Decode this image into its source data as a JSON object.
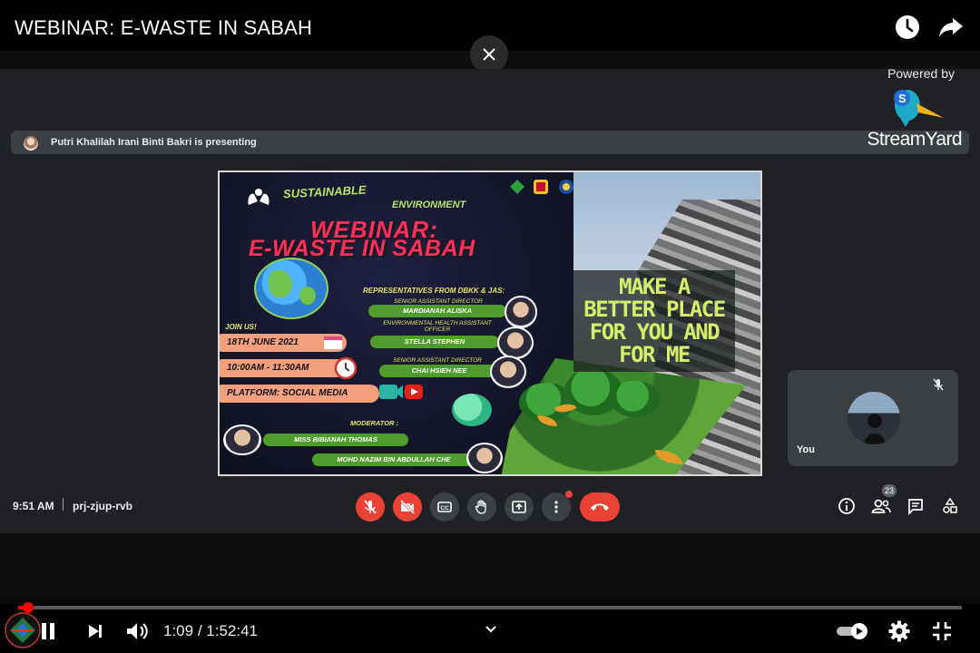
{
  "video": {
    "title": "WEBINAR: E-WASTE IN SABAH"
  },
  "top_actions": {
    "watch_later_icon": "clock-icon",
    "share_icon": "share-arrow-icon",
    "close_icon": "close-icon"
  },
  "meet": {
    "presenting_text": "Putri Khalilah Irani Binti Bakri is presenting",
    "powered_by": "Powered by",
    "brand": "StreamYard",
    "self_label": "You",
    "time": "9:51 AM",
    "meeting_code": "prj-zjup-rvb",
    "participants_count": "23",
    "controls": [
      "mic-off-icon",
      "camera-off-icon",
      "captions-icon",
      "raise-hand-icon",
      "present-icon",
      "more-options-icon",
      "hang-up-icon"
    ],
    "right_controls": [
      "info-icon",
      "people-icon",
      "chat-icon",
      "activities-icon"
    ],
    "colors": {
      "surface": "#202124",
      "button": "#3c4043",
      "danger": "#ea4335"
    }
  },
  "slide": {
    "top_line": "SUSTAINABLE",
    "top_line_2": "ENVIRONMENT",
    "webinar": "WEBINAR:",
    "topic": "E-WASTE IN SABAH",
    "reps_heading": "REPRESENTATIVES FROM DBKK & JAS:",
    "speakers": [
      {
        "role": "SENIOR ASSISTANT DIRECTOR",
        "name": "MARDIANAH ALISKA"
      },
      {
        "role": "ENVIRONMENTAL HEALTH ASSISTANT OFFICER",
        "name": "STELLA STEPHEN"
      },
      {
        "role": "SENIOR ASSISTANT DIRECTOR",
        "name": "CHAI HSIEH NEE"
      }
    ],
    "join_us": "JOIN US!",
    "date": "18TH JUNE 2021",
    "time": "10:00AM - 11:30AM",
    "platform": "PLATFORM: SOCIAL MEDIA",
    "moderator_heading": "MODERATOR :",
    "moderators": [
      "MISS BIBIANAH THOMAS",
      "MOHD NAZIM BIN ABDULLAH CHE"
    ],
    "slogan": "MAKE A BETTER PLACE FOR YOU AND FOR ME",
    "colors": {
      "headline": "#ff2f5c",
      "accent": "#e6e860",
      "pill": "#4f9d2c",
      "slogan": "#d6ee6a"
    }
  },
  "player": {
    "current_time": "1:09",
    "separator": " / ",
    "duration": "1:52:41",
    "progress_fraction": 0.0102,
    "controls": [
      "play-pause-icon",
      "next-icon",
      "volume-icon",
      "chevron-down-icon",
      "autoplay-toggle",
      "settings-gear-icon",
      "exit-fullscreen-icon"
    ],
    "colors": {
      "progress": "#ff0000"
    }
  }
}
